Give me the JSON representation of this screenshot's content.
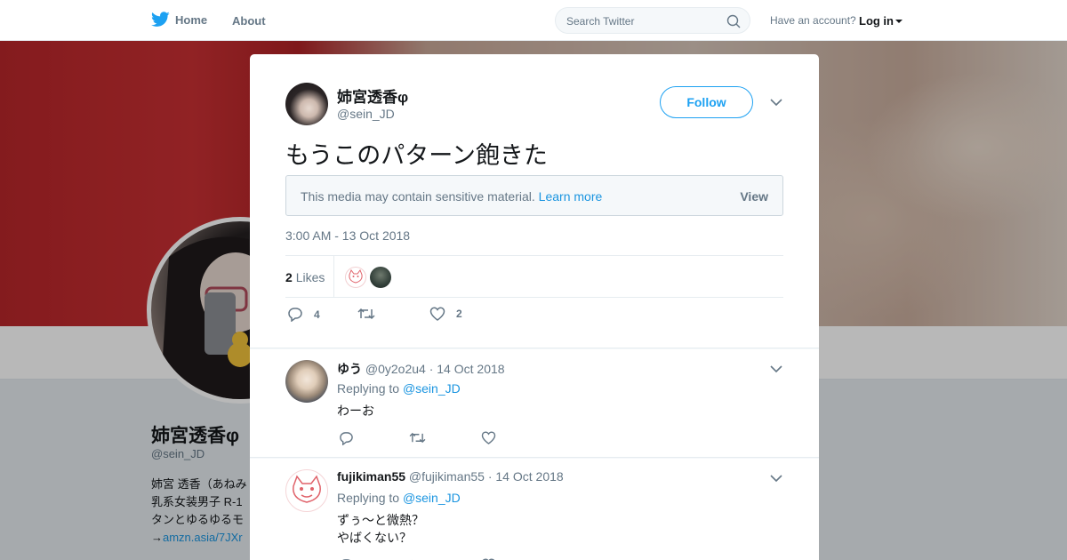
{
  "nav": {
    "home_label": "Home",
    "about_label": "About",
    "search_placeholder": "Search Twitter",
    "account_prompt": "Have an account?",
    "login_label": "Log in",
    "brand_color": "#1da1f2"
  },
  "background_profile": {
    "name": "姉宮透香φ",
    "handle": "@sein_JD",
    "bio_lines": [
      "姉宮 透香（あねみ",
      "乳系女装男子 R-1",
      "タンとゆるゆるモ"
    ],
    "bio_link_prefix": "→",
    "bio_link": "amzn.asia/7JXr"
  },
  "tweet": {
    "author_name": "姉宮透香φ",
    "author_handle": "@sein_JD",
    "follow_label": "Follow",
    "text": "もうこのパターン飽きた",
    "sensitive_message": "This media may contain sensitive material.",
    "learn_more": "Learn more",
    "view_label": "View",
    "timestamp": "3:00 AM - 13 Oct 2018",
    "likes_count": "2",
    "likes_label": "Likes",
    "reply_count": "4",
    "retweet_count": "",
    "like_count": "2"
  },
  "replies": [
    {
      "name": "ゆう",
      "handle": "@0y2o2u4",
      "date": "· 14 Oct 2018",
      "replying_prefix": "Replying to",
      "replying_to": "@sein_JD",
      "lines": [
        "わーお"
      ]
    },
    {
      "name": "fujikiman55",
      "handle": "@fujikiman55",
      "date": "· 14 Oct 2018",
      "replying_prefix": "Replying to",
      "replying_to": "@sein_JD",
      "lines": [
        "ずぅ～と微熱？",
        "やばくない？"
      ]
    }
  ]
}
